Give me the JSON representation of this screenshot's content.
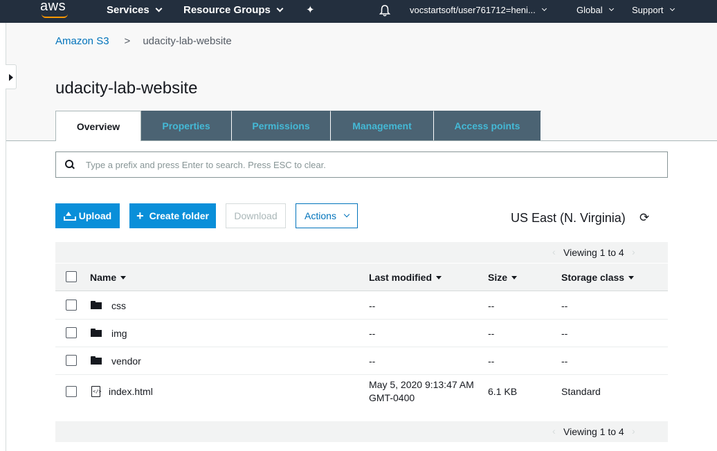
{
  "topnav": {
    "logo": "aws",
    "services": "Services",
    "resource_groups": "Resource Groups",
    "pin_icon": "pin-icon",
    "bell_icon": "bell-icon",
    "account": "vocstartsoft/user761712=heni...",
    "region": "Global",
    "support": "Support"
  },
  "breadcrumb": {
    "root": "Amazon S3",
    "separator": ">",
    "current": "udacity-lab-website"
  },
  "page_title": "udacity-lab-website",
  "tabs": [
    {
      "label": "Overview",
      "active": true
    },
    {
      "label": "Properties",
      "active": false
    },
    {
      "label": "Permissions",
      "active": false
    },
    {
      "label": "Management",
      "active": false
    },
    {
      "label": "Access points",
      "active": false
    }
  ],
  "search": {
    "placeholder": "Type a prefix and press Enter to search. Press ESC to clear.",
    "value": ""
  },
  "actions": {
    "upload": "Upload",
    "create_folder": "Create folder",
    "download": "Download",
    "actions": "Actions"
  },
  "region_label": "US East (N. Virginia)",
  "pager": {
    "text": "Viewing 1 to 4",
    "prev": "‹",
    "next": "›"
  },
  "table": {
    "columns": [
      "Name",
      "Last modified",
      "Size",
      "Storage class"
    ],
    "rows": [
      {
        "type": "folder",
        "name": "css",
        "modified": "--",
        "size": "--",
        "storage": "--"
      },
      {
        "type": "folder",
        "name": "img",
        "modified": "--",
        "size": "--",
        "storage": "--"
      },
      {
        "type": "folder",
        "name": "vendor",
        "modified": "--",
        "size": "--",
        "storage": "--"
      },
      {
        "type": "file",
        "name": "index.html",
        "modified_line1": "May 5, 2020 9:13:47 AM",
        "modified_line2": "GMT-0400",
        "size": "6.1 KB",
        "storage": "Standard"
      }
    ]
  },
  "colors": {
    "nav_bg": "#232f3e",
    "link": "#0073bb",
    "primary_button": "#0a8fd9",
    "tab_bg": "#4b6373",
    "tab_text": "#44b9d6",
    "logo_accent": "#ff9900"
  }
}
